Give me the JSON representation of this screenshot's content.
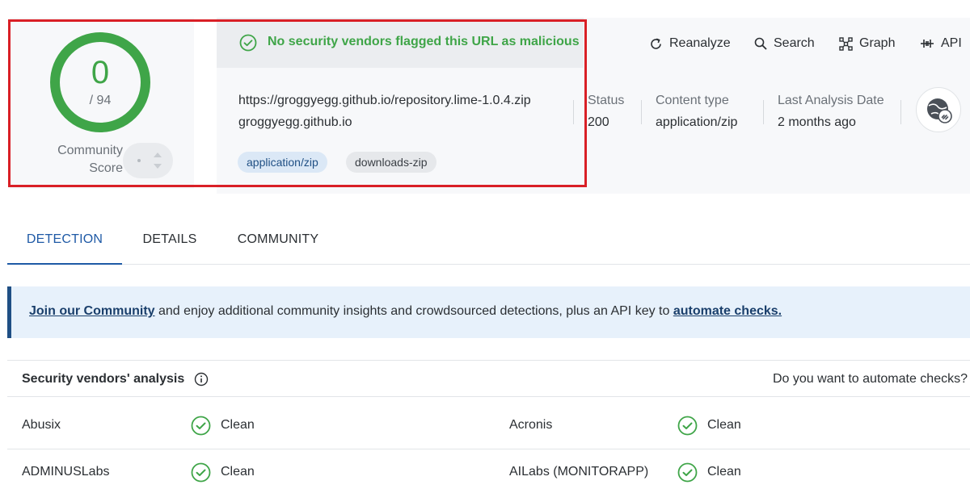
{
  "score": {
    "detections": "0",
    "total": "/ 94",
    "community_label": "Community Score",
    "accent": "#3fa548"
  },
  "verdict": {
    "text": "No security vendors flagged this URL as malicious"
  },
  "toolbar": {
    "reanalyze": "Reanalyze",
    "search": "Search",
    "graph": "Graph",
    "api": "API"
  },
  "target": {
    "url": "https://groggyegg.github.io/repository.lime-1.0.4.zip",
    "domain": "groggyegg.github.io",
    "tags": [
      "application/zip",
      "downloads-zip"
    ]
  },
  "meta": {
    "status_label": "Status",
    "status_value": "200",
    "content_type_label": "Content type",
    "content_type_value": "application/zip",
    "last_analysis_label": "Last Analysis Date",
    "last_analysis_value": "2 months ago"
  },
  "tabs": [
    "DETECTION",
    "DETAILS",
    "COMMUNITY"
  ],
  "banner": {
    "join_link": "Join our Community",
    "middle": " and enjoy additional community insights and crowdsourced detections, plus an API key to ",
    "automate_link": "automate checks."
  },
  "vendors": {
    "title": "Security vendors' analysis",
    "automate_prompt": "Do you want to automate checks?",
    "rows": [
      {
        "left_name": "Abusix",
        "left_result": "Clean",
        "right_name": "Acronis",
        "right_result": "Clean"
      },
      {
        "left_name": "ADMINUSLabs",
        "left_result": "Clean",
        "right_name": "AILabs (MONITORAPP)",
        "right_result": "Clean"
      }
    ]
  },
  "colors": {
    "highlight": "#d91f26",
    "clean": "#3fa548",
    "link": "#1f5aa6"
  }
}
